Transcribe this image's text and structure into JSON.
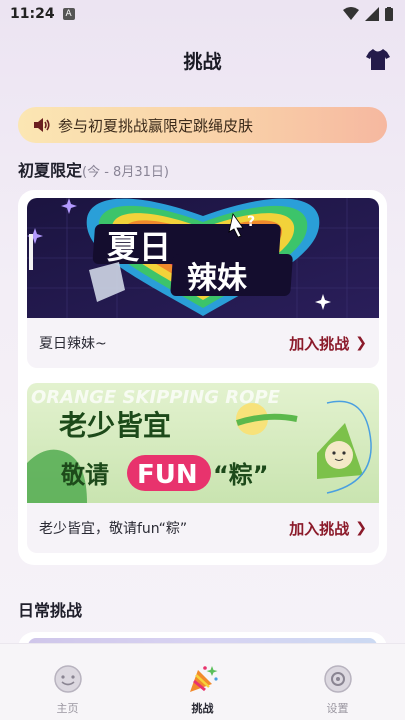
{
  "status_bar": {
    "time": "11:24",
    "notif_letter": "A"
  },
  "header": {
    "title": "挑战",
    "shirt_icon": "tshirt-icon"
  },
  "banner": {
    "text": "参与初夏挑战赢限定跳绳皮肤",
    "icon": "speaker-icon"
  },
  "section": {
    "title": "初夏限定",
    "subtitle": "(今 - 8月31日)"
  },
  "cards": [
    {
      "image_text": [
        "夏日",
        "辣妹"
      ],
      "name": "夏日辣妹~",
      "action": "加入挑战"
    },
    {
      "image_text": [
        "老少皆宜",
        "敬请",
        "FUN",
        "“粽”"
      ],
      "watermark": "ORANGE SKIPPING ROPE",
      "name": "老少皆宜，敬请fun“粽”",
      "action": "加入挑战"
    }
  ],
  "daily": {
    "title": "日常挑战"
  },
  "tabs": [
    {
      "label": "主页",
      "icon": "home-face-icon"
    },
    {
      "label": "挑战",
      "icon": "party-popper-icon"
    },
    {
      "label": "设置",
      "icon": "settings-disc-icon"
    }
  ],
  "colors": {
    "accent": "#8b1a2a",
    "banner_start": "#fbe6b3",
    "banner_end": "#f6b8a0"
  }
}
